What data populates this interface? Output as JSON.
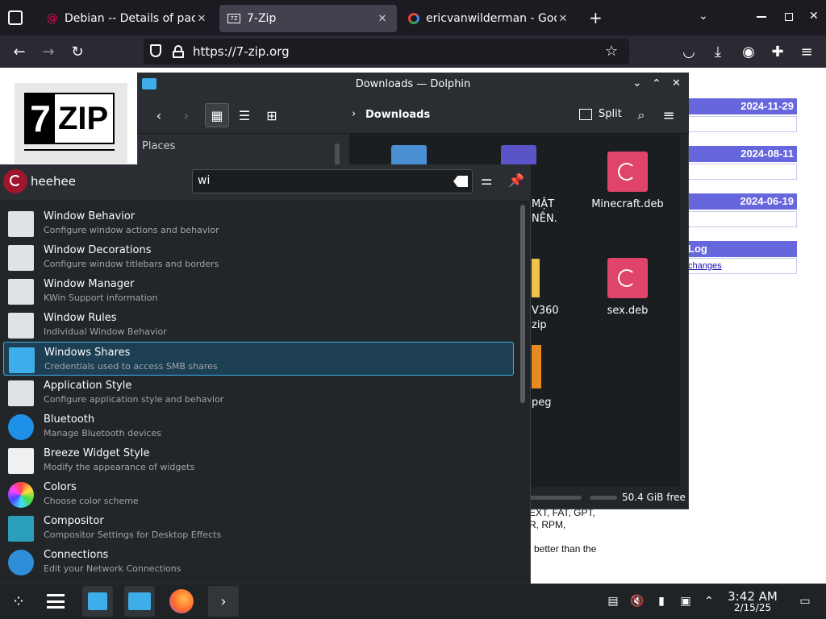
{
  "browser": {
    "tabs": [
      {
        "title": "Debian -- Details of package",
        "icon": "debian-icon"
      },
      {
        "title": "7-Zip",
        "icon": "7zip-icon"
      },
      {
        "title": "ericvanwilderman - Google",
        "icon": "google-icon"
      }
    ],
    "url": "https://7-zip.org"
  },
  "webpage": {
    "logo_text": "7ZIP",
    "dates": [
      "2024-11-29",
      "2024-08-11",
      "2024-06-19"
    ],
    "log_label": "Log",
    "changes_link": "changes",
    "text_lines": [
      "EXT, FAT, GPT,",
      "R, RPM,",
      "better than the"
    ]
  },
  "dolphin": {
    "title": "Downloads — Dolphin",
    "location": "Downloads",
    "split_label": "Split",
    "places_label": "Places",
    "status_free": "50.4 GiB free",
    "files": [
      {
        "name": "Minecraft.deb",
        "type": "deb"
      },
      {
        "name": "sex.deb",
        "type": "deb"
      }
    ],
    "partial_labels": [
      "MẬT",
      "NÊN.",
      "V360",
      "zip",
      "peg"
    ]
  },
  "launcher": {
    "username": "heehee",
    "search_value": "wi",
    "results": [
      {
        "title": "Window Behavior",
        "subtitle": "Configure window actions and behavior",
        "icon": "window-behavior-icon"
      },
      {
        "title": "Window Decorations",
        "subtitle": "Configure window titlebars and borders",
        "icon": "window-decorations-icon"
      },
      {
        "title": "Window Manager",
        "subtitle": "KWin Support information",
        "icon": "window-manager-icon"
      },
      {
        "title": "Window Rules",
        "subtitle": "Individual Window Behavior",
        "icon": "window-rules-icon"
      },
      {
        "title": "Windows Shares",
        "subtitle": "Credentials used to access SMB shares",
        "icon": "windows-shares-icon"
      },
      {
        "title": "Application Style",
        "subtitle": "Configure application style and behavior",
        "icon": "application-style-icon"
      },
      {
        "title": "Bluetooth",
        "subtitle": "Manage Bluetooth devices",
        "icon": "bluetooth-icon"
      },
      {
        "title": "Breeze Widget Style",
        "subtitle": "Modify the appearance of widgets",
        "icon": "breeze-widget-icon"
      },
      {
        "title": "Colors",
        "subtitle": "Choose color scheme",
        "icon": "colors-icon"
      },
      {
        "title": "Compositor",
        "subtitle": "Compositor Settings for Desktop Effects",
        "icon": "compositor-icon"
      },
      {
        "title": "Connections",
        "subtitle": "Edit your Network Connections",
        "icon": "connections-icon"
      }
    ],
    "selected_index": 4
  },
  "taskbar": {
    "time": "3:42 AM",
    "date": "2/15/25"
  },
  "colors": {
    "accent": "#3daee9",
    "selection_bg": "#1d3f54",
    "deb_pink": "#e0446a",
    "web_band": "#6666dd"
  }
}
